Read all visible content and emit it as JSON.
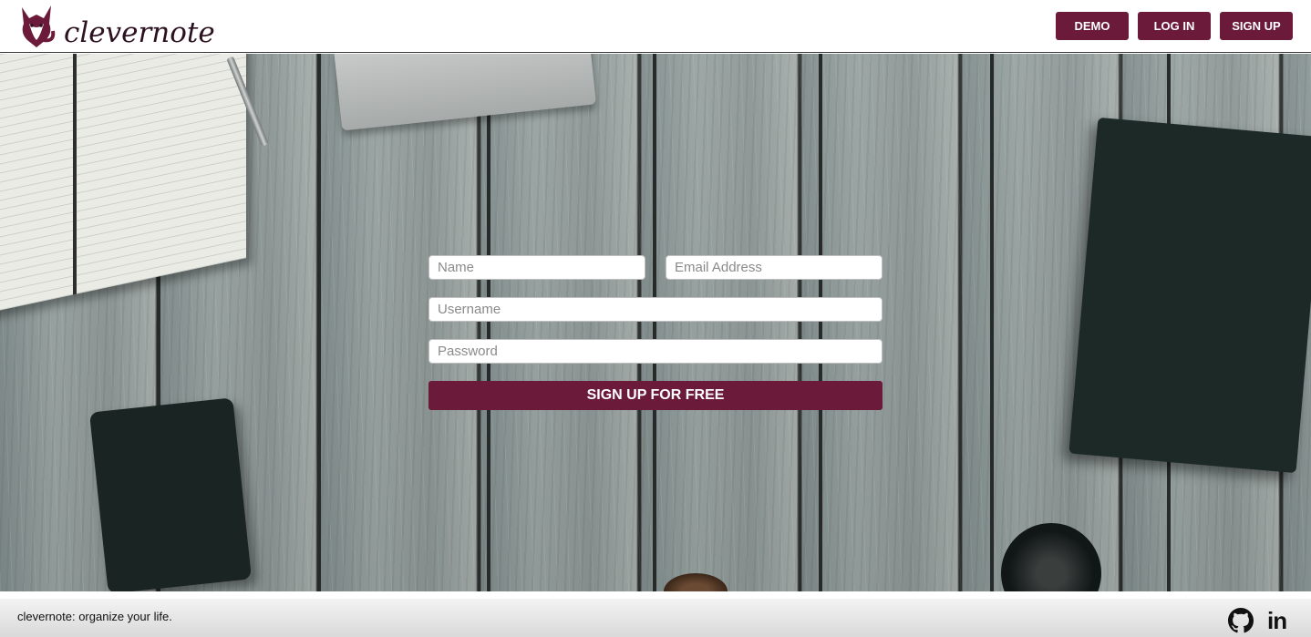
{
  "header": {
    "brand": "clevernote",
    "nav": {
      "demo_label": "DEMO",
      "login_label": "LOG IN",
      "signup_label": "SIGN UP"
    }
  },
  "signup_form": {
    "name_placeholder": "Name",
    "email_placeholder": "Email Address",
    "username_placeholder": "Username",
    "password_placeholder": "Password",
    "submit_label": "SIGN UP FOR FREE"
  },
  "footer": {
    "tagline": "clevernote: organize your life.",
    "links": {
      "github_icon": "github-icon",
      "linkedin_icon": "linkedin-icon",
      "linkedin_text": "in"
    }
  },
  "colors": {
    "brand_primary": "#6b1a39",
    "brand_dark": "#2c1220"
  },
  "icons": {
    "logo": "fox-logo-icon"
  }
}
